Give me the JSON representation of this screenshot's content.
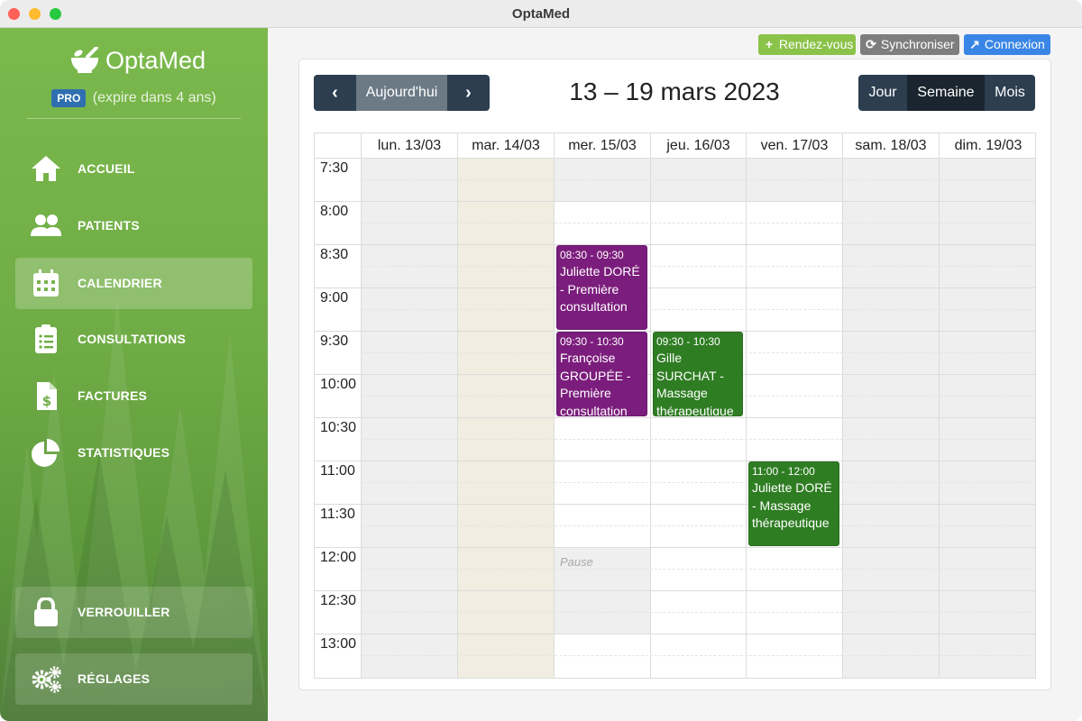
{
  "window": {
    "title": "OptaMed"
  },
  "sidebar": {
    "brand": "OptaMed",
    "license_badge": "PRO",
    "license_text": "(expire dans 4 ans)",
    "items": [
      {
        "label": "ACCUEIL",
        "icon": "home-icon"
      },
      {
        "label": "PATIENTS",
        "icon": "users-icon"
      },
      {
        "label": "CALENDRIER",
        "icon": "calendar-icon",
        "active": true
      },
      {
        "label": "CONSULTATIONS",
        "icon": "clipboard-icon"
      },
      {
        "label": "FACTURES",
        "icon": "invoice-icon"
      },
      {
        "label": "STATISTIQUES",
        "icon": "pie-chart-icon"
      }
    ],
    "bottom": [
      {
        "label": "VERROUILLER",
        "icon": "lock-icon"
      },
      {
        "label": "RÉGLAGES",
        "icon": "gears-icon"
      }
    ]
  },
  "toolbar": {
    "new_appointment": "Rendez-vous",
    "sync": "Synchroniser",
    "login": "Connexion"
  },
  "calendar": {
    "today_label": "Aujourd'hui",
    "range_title": "13 – 19 mars 2023",
    "views": {
      "day": "Jour",
      "week": "Semaine",
      "month": "Mois"
    },
    "active_view": "Semaine",
    "days": [
      "lun. 13/03",
      "mar. 14/03",
      "mer. 15/03",
      "jeu. 16/03",
      "ven. 17/03",
      "sam. 18/03",
      "dim. 19/03"
    ],
    "times": [
      "7:30",
      "8:00",
      "8:30",
      "9:00",
      "9:30",
      "10:00",
      "10:30",
      "11:00",
      "11:30",
      "12:00",
      "12:30",
      "13:00"
    ],
    "pause_label": "Pause",
    "events": [
      {
        "time": "08:30 - 09:30",
        "title": "Juliette DORÉ - Première consultation",
        "day": 2,
        "color": "#7b1d7c"
      },
      {
        "time": "09:30 - 10:30",
        "title": "Françoise GROUPÉE - Première consultation",
        "day": 2,
        "color": "#7b1d7c"
      },
      {
        "time": "09:30 - 10:30",
        "title": "Gille SURCHAT - Massage thérapeutique",
        "day": 3,
        "color": "#2f7d23"
      },
      {
        "time": "11:00 - 12:00",
        "title": "Juliette DORÉ - Massage thérapeutique",
        "day": 4,
        "color": "#2f7d23"
      }
    ]
  },
  "colors": {
    "sidebar_green": "#6fac45",
    "nav_dark": "#2c3e50",
    "event_purple": "#7b1d7c",
    "event_green": "#2f7d23",
    "unavailable_gray": "#efefef",
    "today_highlight": "#f1ede0"
  }
}
